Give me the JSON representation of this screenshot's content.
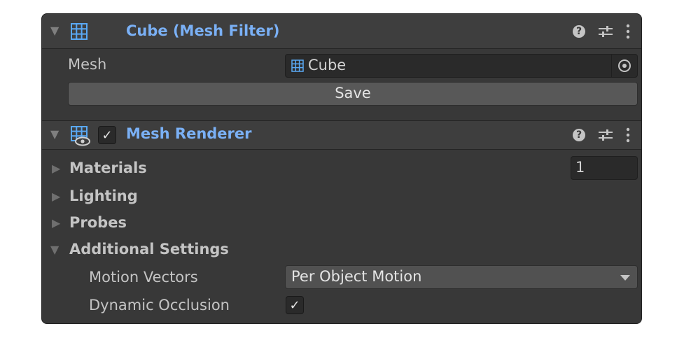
{
  "mesh_filter": {
    "title": "Cube (Mesh Filter)",
    "mesh_label": "Mesh",
    "mesh_value": "Cube",
    "save_label": "Save",
    "icon": "mesh-grid-icon"
  },
  "mesh_renderer": {
    "title": "Mesh Renderer",
    "enabled_check": "✓",
    "icon": "mesh-renderer-icon",
    "materials_label": "Materials",
    "materials_count": "1",
    "lighting_label": "Lighting",
    "probes_label": "Probes",
    "additional_label": "Additional Settings",
    "motion_vectors_label": "Motion Vectors",
    "motion_vectors_value": "Per Object Motion",
    "dynamic_occlusion_label": "Dynamic Occlusion",
    "dynamic_occlusion_check": "✓"
  },
  "header_buttons": {
    "help": "?"
  },
  "colors": {
    "panel_bg": "#383838",
    "title_accent": "#7ab0f5",
    "icon_accent": "#5aa9f5"
  }
}
